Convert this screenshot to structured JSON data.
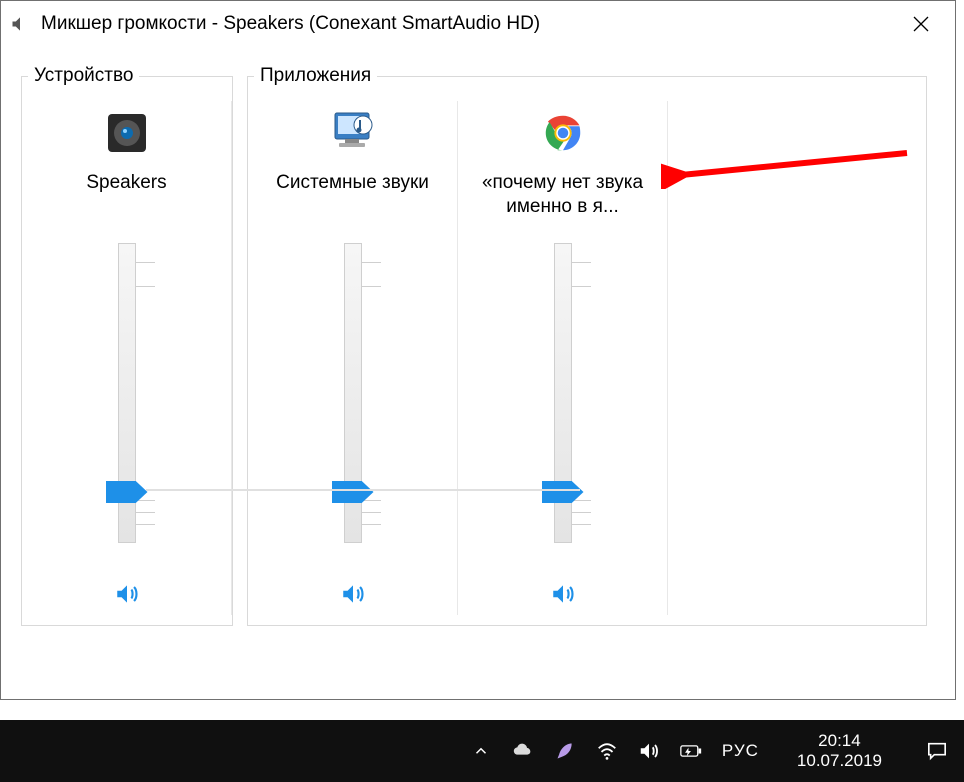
{
  "window": {
    "title": "Микшер громкости - Speakers (Conexant SmartAudio HD)"
  },
  "groups": {
    "device_legend": "Устройство",
    "apps_legend": "Приложения"
  },
  "channels": [
    {
      "label": "Speakers",
      "icon": "speaker-device",
      "value": 20
    },
    {
      "label": "Системные звуки",
      "icon": "system-sounds",
      "value": 20
    },
    {
      "label": "«почему нет звука именно в я...",
      "icon": "chrome",
      "value": 20
    }
  ],
  "colors": {
    "accent": "#1e90e8",
    "arrow": "#ff0000"
  },
  "taskbar": {
    "lang": "РУС",
    "time": "20:14",
    "date": "10.07.2019"
  }
}
